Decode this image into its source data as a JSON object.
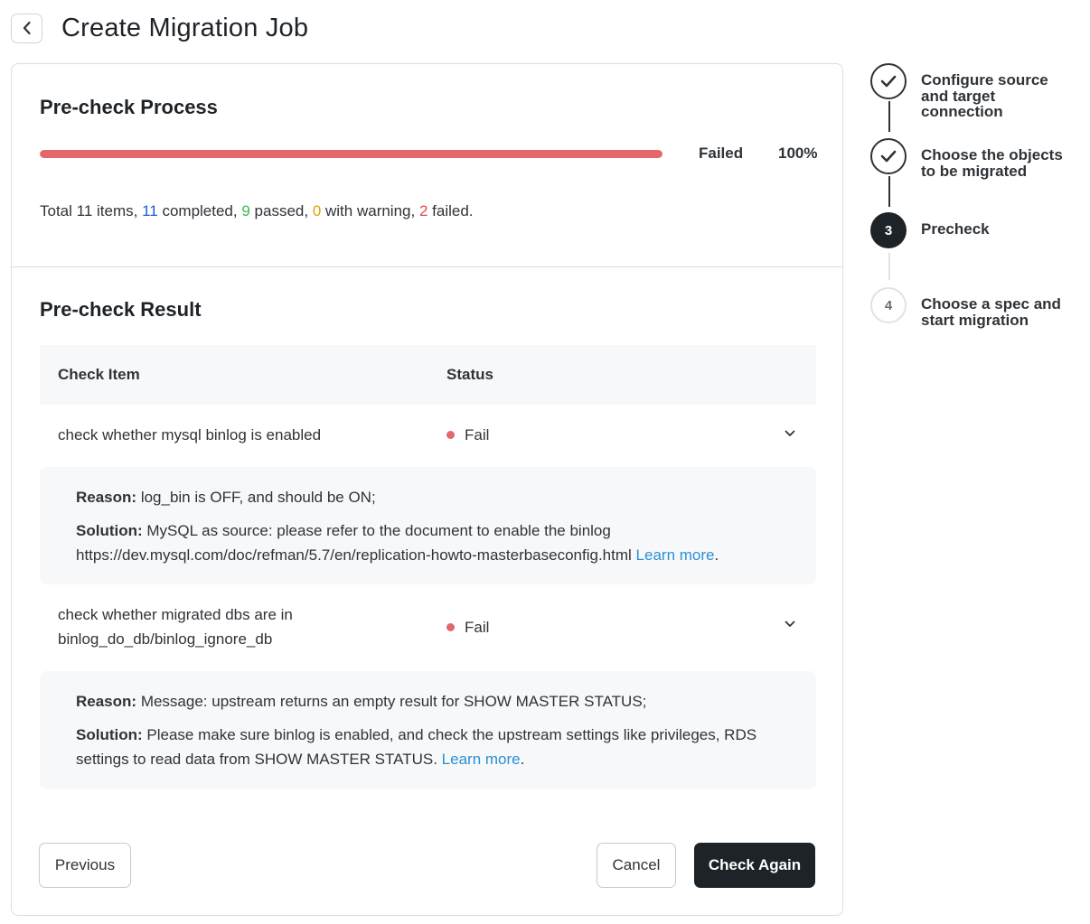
{
  "header": {
    "title": "Create Migration Job"
  },
  "process": {
    "title": "Pre-check Process",
    "progress": 1.0,
    "state": "Failed",
    "percent": "100%",
    "summary": {
      "prefix": "Total 11 items, ",
      "completed_count": "11",
      "completed_label": " completed, ",
      "passed_count": "9",
      "passed_label": " passed, ",
      "warning_count": "0",
      "warning_label": " with warning, ",
      "failed_count": "2",
      "failed_label": " failed."
    }
  },
  "result": {
    "title": "Pre-check Result",
    "columns": {
      "item": "Check Item",
      "status": "Status"
    },
    "rows": [
      {
        "item": "check whether mysql binlog is enabled",
        "status": "Fail",
        "reason_label": "Reason:",
        "reason": "log_bin is OFF, and should be ON;",
        "solution_label": "Solution:",
        "solution": "MySQL as source: please refer to the document to enable the binlog https://dev.mysql.com/doc/refman/5.7/en/replication-howto-masterbaseconfig.html",
        "learn_more": "Learn more",
        "trail": "."
      },
      {
        "item": "check whether migrated dbs are in binlog_do_db/binlog_ignore_db",
        "status": "Fail",
        "reason_label": "Reason:",
        "reason": "Message: upstream returns an empty result for SHOW MASTER STATUS;",
        "solution_label": "Solution:",
        "solution": "Please make sure binlog is enabled, and check the upstream settings like privileges, RDS settings to read data from SHOW MASTER STATUS.",
        "learn_more": "Learn more",
        "trail": "."
      }
    ]
  },
  "buttons": {
    "previous": "Previous",
    "cancel": "Cancel",
    "check_again": "Check Again"
  },
  "steps": [
    {
      "label": "Configure source and target connection",
      "state": "done"
    },
    {
      "label": "Choose the objects to be migrated",
      "state": "done"
    },
    {
      "label": "Precheck",
      "number": "3",
      "state": "active"
    },
    {
      "label": "Choose a spec and start migration",
      "number": "4",
      "state": "todo"
    }
  ],
  "colors": {
    "fail": "#e5676a",
    "link": "#2b8fd6",
    "primary": "#1e2327"
  }
}
